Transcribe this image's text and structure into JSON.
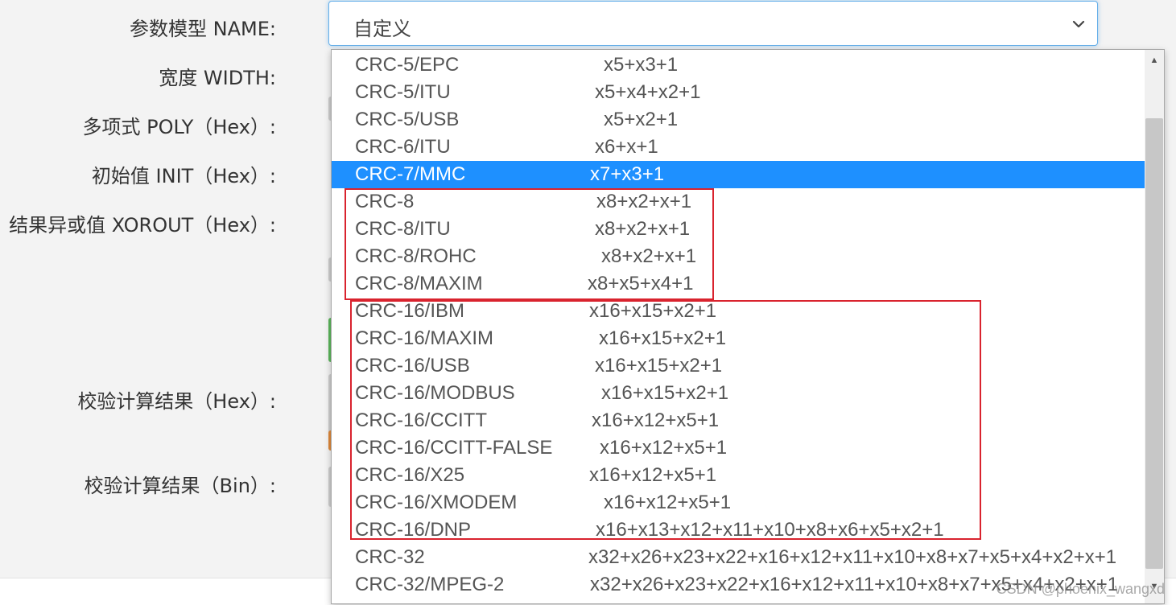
{
  "form": {
    "labels": {
      "name": "参数模型 NAME:",
      "width": "宽度 WIDTH:",
      "poly": "多项式 POLY（Hex）:",
      "init": "初始值 INIT（Hex）:",
      "xorout": "结果异或值 XOROUT（Hex）:",
      "result_hex": "校验计算结果（Hex）:",
      "result_bin": "校验计算结果（Bin）:"
    },
    "select_value": "自定义"
  },
  "dropdown": {
    "options": [
      {
        "name": "CRC-5/EPC",
        "poly": "x5+x3+1"
      },
      {
        "name": "CRC-5/ITU",
        "poly": "x5+x4+x2+1"
      },
      {
        "name": "CRC-5/USB",
        "poly": "x5+x2+1"
      },
      {
        "name": "CRC-6/ITU",
        "poly": "x6+x+1"
      },
      {
        "name": "CRC-7/MMC",
        "poly": "x7+x3+1"
      },
      {
        "name": "CRC-8",
        "poly": "x8+x2+x+1"
      },
      {
        "name": "CRC-8/ITU",
        "poly": "x8+x2+x+1"
      },
      {
        "name": "CRC-8/ROHC",
        "poly": "x8+x2+x+1"
      },
      {
        "name": "CRC-8/MAXIM",
        "poly": "x8+x5+x4+1"
      },
      {
        "name": "CRC-16/IBM",
        "poly": "x16+x15+x2+1"
      },
      {
        "name": "CRC-16/MAXIM",
        "poly": "x16+x15+x2+1"
      },
      {
        "name": "CRC-16/USB",
        "poly": "x16+x15+x2+1"
      },
      {
        "name": "CRC-16/MODBUS",
        "poly": "x16+x15+x2+1"
      },
      {
        "name": "CRC-16/CCITT",
        "poly": "x16+x12+x5+1"
      },
      {
        "name": "CRC-16/CCITT-FALSE",
        "poly": "x16+x12+x5+1"
      },
      {
        "name": "CRC-16/X25",
        "poly": "x16+x12+x5+1"
      },
      {
        "name": "CRC-16/XMODEM",
        "poly": "x16+x12+x5+1"
      },
      {
        "name": "CRC-16/DNP",
        "poly": "x16+x13+x12+x11+x10+x8+x6+x5+x2+1"
      },
      {
        "name": "CRC-32",
        "poly": "x32+x26+x23+x22+x16+x12+x11+x10+x8+x7+x5+x4+x2+x+1"
      },
      {
        "name": "CRC-32/MPEG-2",
        "poly": "x32+x26+x23+x22+x16+x12+x11+x10+x8+x7+x5+x4+x2+x+1"
      }
    ],
    "selected_index": 4
  },
  "icons": {
    "select_arrow": "chevron-down-icon",
    "scroll_up": "arrow-up-icon",
    "scroll_down": "arrow-down-icon"
  },
  "colors": {
    "selected_bg": "#1e90ff",
    "highlight_border": "#d9232e",
    "focus_border": "#66afe9"
  },
  "watermark": "CSDN @phoenix_wangxd"
}
